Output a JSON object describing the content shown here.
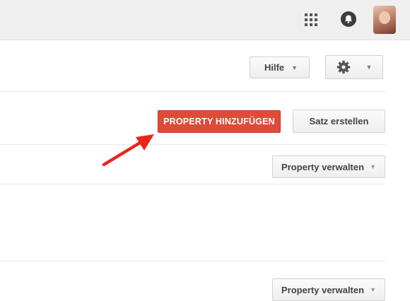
{
  "toolbar": {
    "icons": [
      "apps-icon",
      "notifications-icon",
      "avatar"
    ]
  },
  "header_buttons": {
    "help_label": "Hilfe",
    "settings_icon": "gear-icon"
  },
  "actions": {
    "add_property_label": "PROPERTY HINZUFÜGEN",
    "create_set_label": "Satz erstellen"
  },
  "rows": [
    {
      "manage_label": "Property verwalten"
    },
    {
      "manage_label": "Property verwalten"
    }
  ],
  "colors": {
    "primary": "#dd4b39",
    "arrow": "#e8251c"
  }
}
